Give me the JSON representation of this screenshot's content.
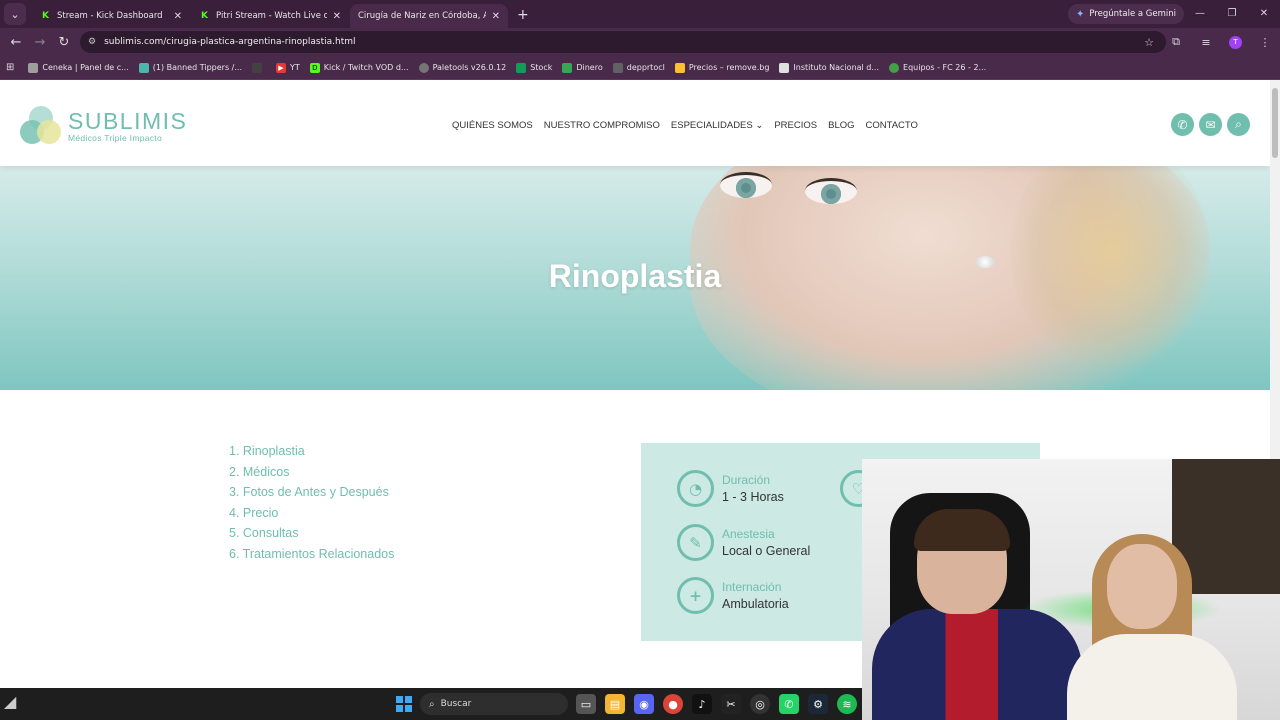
{
  "browser": {
    "tabs": [
      {
        "title": "Stream - Kick Dashboard",
        "favicon": "K",
        "active": false
      },
      {
        "title": "Pitri Stream - Watch Live on Kick",
        "favicon": "K",
        "active": false
      },
      {
        "title": "Cirugía de Nariz en Córdoba, Argentina",
        "favicon": "S",
        "active": true
      }
    ],
    "new_tab": "+",
    "gemini_label": "Pregúntale a Gemini",
    "url": "sublimis.com/cirugia-plastica-argentina-rinoplastia.html",
    "profile_initial": "T",
    "bookmarks": [
      {
        "label": "Ceneka | Panel de c...",
        "color": "#9e9e9e"
      },
      {
        "label": "(1) Banned Tippers /...",
        "color": "#4db6ac"
      },
      {
        "label": "",
        "color": "#424242"
      },
      {
        "label": "YT",
        "color": "#e53935"
      },
      {
        "label": "Kick / Twitch VOD d...",
        "color": "#53fc18"
      },
      {
        "label": "Paletools v26.0.12",
        "color": "#757575"
      },
      {
        "label": "Stock",
        "color": "#0f9d58"
      },
      {
        "label": "Dinero",
        "color": "#34a853"
      },
      {
        "label": "depprtocl",
        "color": "#616161"
      },
      {
        "label": "Precios – remove.bg",
        "color": "#fbc02d"
      },
      {
        "label": "Instituto Nacional d...",
        "color": "#e0e0e0"
      },
      {
        "label": "Equipos - FC 26 - 2...",
        "color": "#43a047"
      }
    ]
  },
  "site": {
    "brand": {
      "name": "SUBLIMIS",
      "tagline": "Médicos Triple Impacto"
    },
    "nav": [
      "QUIÉNES SOMOS",
      "NUESTRO COMPROMISO",
      "ESPECIALIDADES",
      "PRECIOS",
      "BLOG",
      "CONTACTO"
    ],
    "nav_dropdown_marker": "⌄",
    "hero_title": "Rinoplastia",
    "toc": [
      "1. Rinoplastia",
      "2. Médicos",
      "3. Fotos de Antes y Después",
      "4. Precio",
      "5. Consultas",
      "6. Tratamientos Relacionados"
    ],
    "info": [
      {
        "label": "Duración",
        "value": "1 - 3 Horas"
      },
      {
        "label": "Anestesia",
        "value": "Local o General"
      },
      {
        "label": "Internación",
        "value": "Ambulatoria"
      }
    ],
    "accent_color": "#6fbeae"
  },
  "taskbar": {
    "search_placeholder": "Buscar"
  }
}
